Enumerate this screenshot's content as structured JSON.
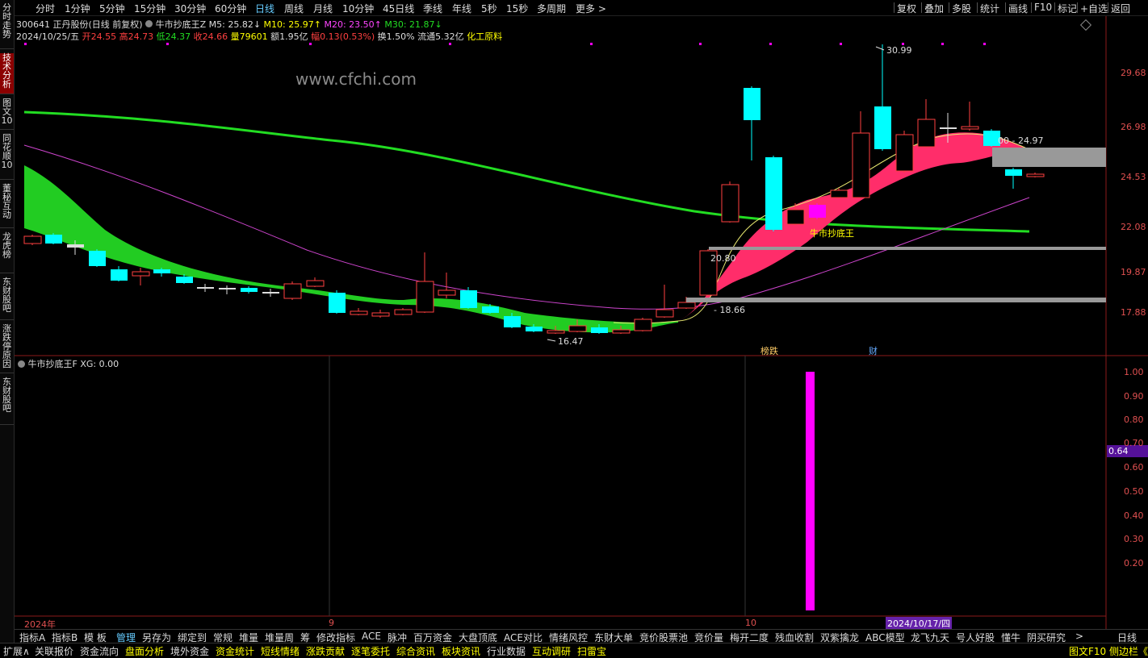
{
  "left_rail": [
    "分时走势",
    "技术分析",
    "图文10",
    "同花顺10",
    "董秘互动",
    "龙虎榜",
    "东财股吧",
    "涨跌停原因",
    "东财股吧"
  ],
  "topbar": {
    "periods": [
      "分时",
      "1分钟",
      "5分钟",
      "15分钟",
      "30分钟",
      "60分钟",
      "日线",
      "周线",
      "月线",
      "10分钟",
      "45日线",
      "季线",
      "年线",
      "5秒",
      "15秒",
      "多周期",
      "更多 >"
    ],
    "selected": "日线",
    "right": [
      "复权",
      "叠加",
      "多股",
      "统计",
      "画线",
      "F10",
      "标记",
      "+自选",
      "返回"
    ]
  },
  "stock": {
    "code": "300641",
    "name": "正丹股份(日线 前复权)",
    "indicator": "牛市抄底王Z",
    "ma5": "M5: 25.82↓",
    "ma10": "M10: 25.97↑",
    "ma20": "M20: 23.50↑",
    "ma30": "M30: 21.87↓",
    "date": "2024/10/25/五",
    "open": "开24.55",
    "high": "高24.73",
    "low": "低24.37",
    "close": "收24.66",
    "volume": "量79601",
    "amount": "额1.95亿",
    "change": "幅0.13(0.53%)",
    "turnover": "换1.50%",
    "float": "流通5.32亿",
    "sector": "化工原料"
  },
  "watermark": "www.cfchi.com",
  "annotations": {
    "high": "30.99",
    "low": "16.47",
    "lvl1": "20.80",
    "lvl2": "- 18.66",
    "lvl3": "00 - 24.97",
    "signal": "牛市抄底王",
    "tag1": "榜跌",
    "tag2": "财"
  },
  "price_axis": [
    "29.68",
    "26.98",
    "24.53",
    "22.08",
    "19.87",
    "17.88"
  ],
  "sub": {
    "title": "牛市抄底王F  XG: 0.00",
    "axis": [
      "1.00",
      "0.90",
      "0.80",
      "0.70",
      "0.60",
      "0.50",
      "0.40",
      "0.30",
      "0.20"
    ],
    "marker": "0.64"
  },
  "time_axis": [
    "2024年",
    "9",
    "10",
    "2024/10/17/四"
  ],
  "bottom_tabs": [
    "指标A",
    "指标B",
    "模 板",
    "管理",
    "另存为",
    "绑定到",
    "常规",
    "堆量",
    "堆量周",
    "筹",
    "修改指标",
    "ACE",
    "脉冲",
    "百万资金",
    "大盘顶底",
    "ACE对比",
    "情绪风控",
    "东财大单",
    "竞价股票池",
    "竞价量",
    "梅开二度",
    "残血收割",
    "双紫擒龙",
    "ABC模型",
    "龙飞九天",
    "号人好股",
    "懂牛",
    "阴买研究"
  ],
  "bottom_right": [
    "日线"
  ],
  "status_bar": [
    "扩展∧",
    "关联报价",
    "资金流向",
    "盘面分析",
    "境外资金",
    "资金统计",
    "短线情绪",
    "涨跌贡献",
    "逐笔委托",
    "综合资讯",
    "板块资讯",
    "行业数据",
    "互动调研",
    "扫雷宝"
  ],
  "status_right": "图文F10 侧边栏《",
  "colors": {
    "up": "#ff4040",
    "down": "#00ffff",
    "ma_green": "#22dd22",
    "ma_purple": "#cc44cc",
    "band_green": "#22cc22",
    "band_red": "#ff2d6a",
    "magenta": "#ff00ff"
  }
}
